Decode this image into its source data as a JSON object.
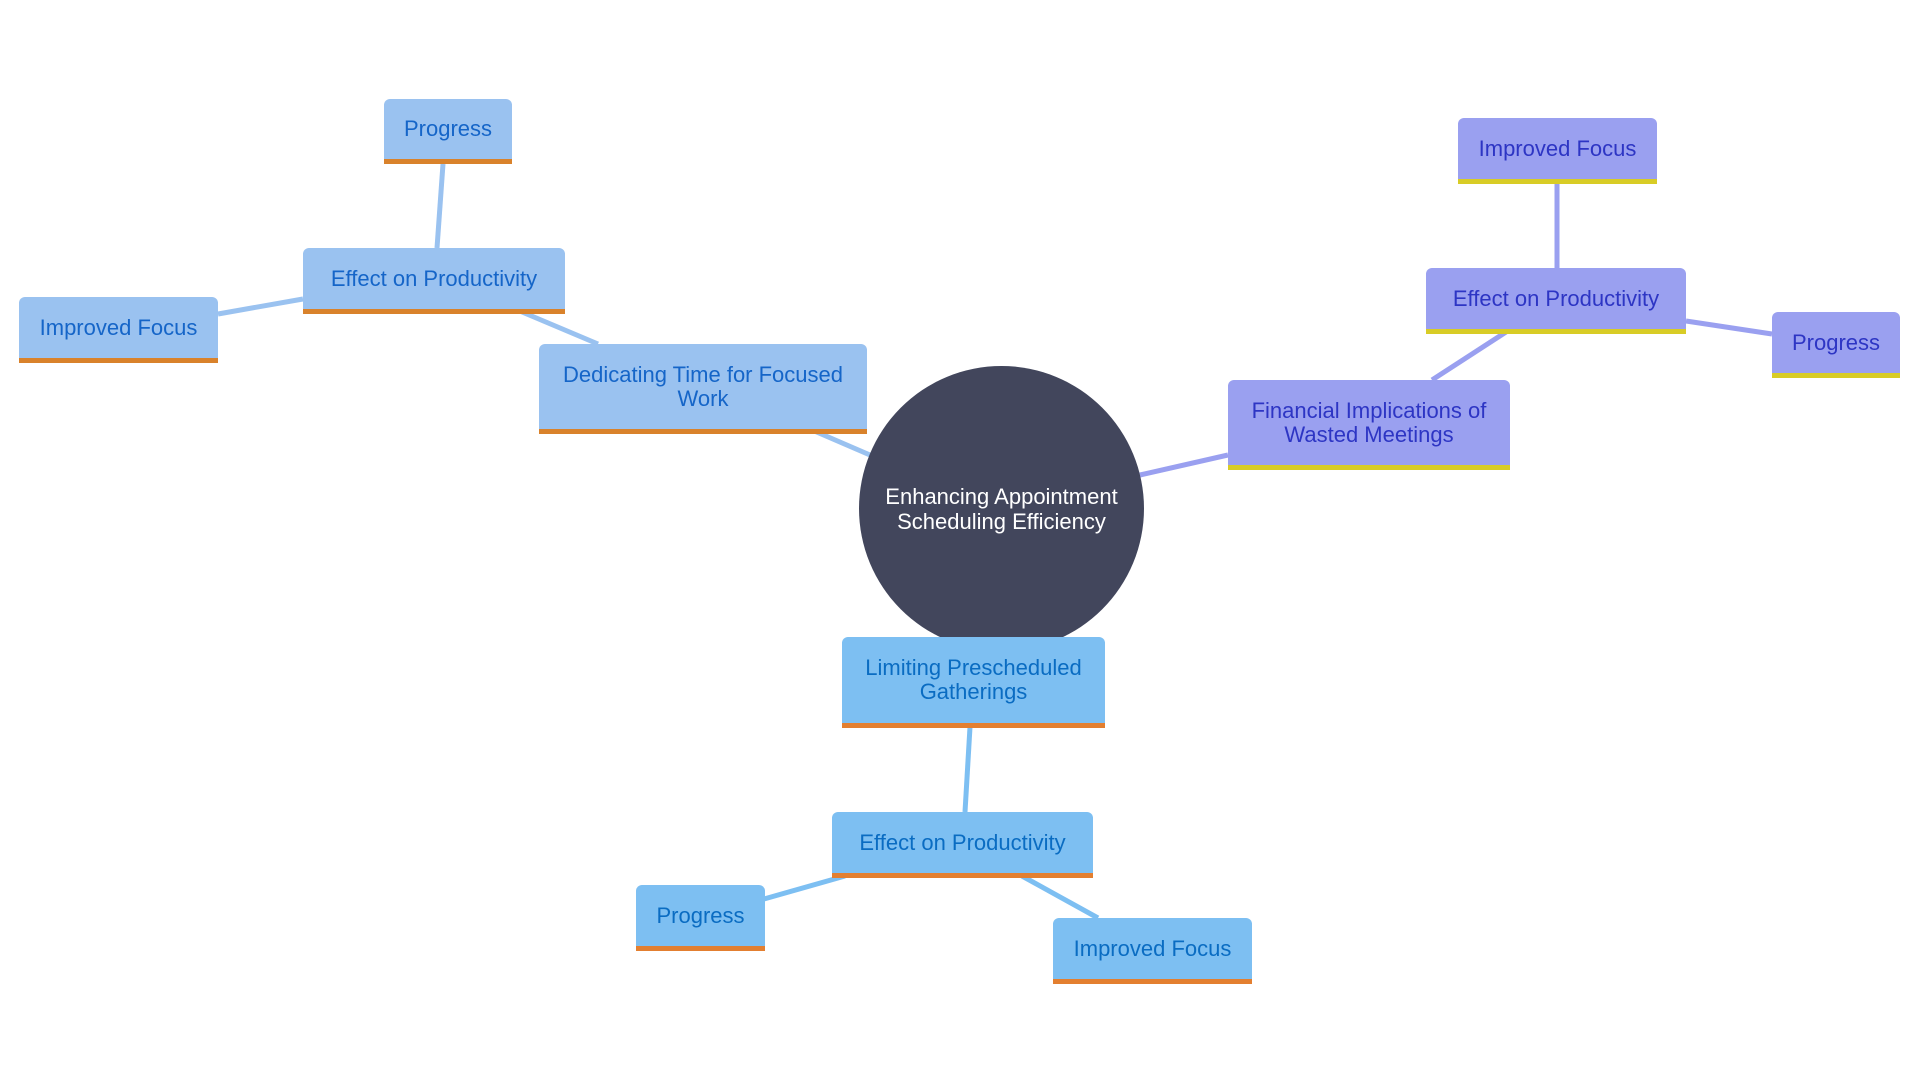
{
  "diagram": {
    "type": "mindmap",
    "root": {
      "id": "root",
      "label": "Enhancing Appointment Scheduling Efficiency",
      "color": "#42465c"
    },
    "branches": [
      {
        "id": "dedicating",
        "label": "Dedicating Time for Focused Work",
        "theme": "t-left",
        "fill": "#9ac2f0",
        "text": "#1565c8",
        "accent": "#d9822b",
        "edge": "#9ac2f0",
        "children": [
          {
            "id": "dedicating-effect",
            "label": "Effect on Productivity",
            "children": [
              {
                "id": "dedicating-progress",
                "label": "Progress"
              },
              {
                "id": "dedicating-focus",
                "label": "Improved Focus"
              }
            ]
          }
        ]
      },
      {
        "id": "financial",
        "label": "Financial Implications of Wasted Meetings",
        "theme": "t-right",
        "fill": "#9aa0f0",
        "text": "#2d35c4",
        "accent": "#d8cc26",
        "edge": "#9aa0f0",
        "children": [
          {
            "id": "financial-effect",
            "label": "Effect on Productivity",
            "children": [
              {
                "id": "financial-focus",
                "label": "Improved Focus"
              },
              {
                "id": "financial-progress",
                "label": "Progress"
              }
            ]
          }
        ]
      },
      {
        "id": "limiting",
        "label": "Limiting Prescheduled Gatherings",
        "theme": "t-bottom",
        "fill": "#7dbff2",
        "text": "#0a6cc2",
        "accent": "#e37f30",
        "edge": "#7dbff2",
        "children": [
          {
            "id": "limiting-effect",
            "label": "Effect on Productivity",
            "children": [
              {
                "id": "limiting-progress",
                "label": "Progress"
              },
              {
                "id": "limiting-focus",
                "label": "Improved Focus"
              }
            ]
          }
        ]
      }
    ]
  },
  "labels": {
    "root": "Enhancing Appointment Scheduling Efficiency",
    "dedicating": "Dedicating Time for Focused Work",
    "dedicating_effect": "Effect on Productivity",
    "dedicating_progress": "Progress",
    "dedicating_focus": "Improved Focus",
    "financial": "Financial Implications of Wasted Meetings",
    "financial_effect": "Effect on Productivity",
    "financial_focus": "Improved Focus",
    "financial_progress": "Progress",
    "limiting": "Limiting Prescheduled Gatherings",
    "limiting_effect": "Effect on Productivity",
    "limiting_progress": "Progress",
    "limiting_focus": "Improved Focus"
  }
}
